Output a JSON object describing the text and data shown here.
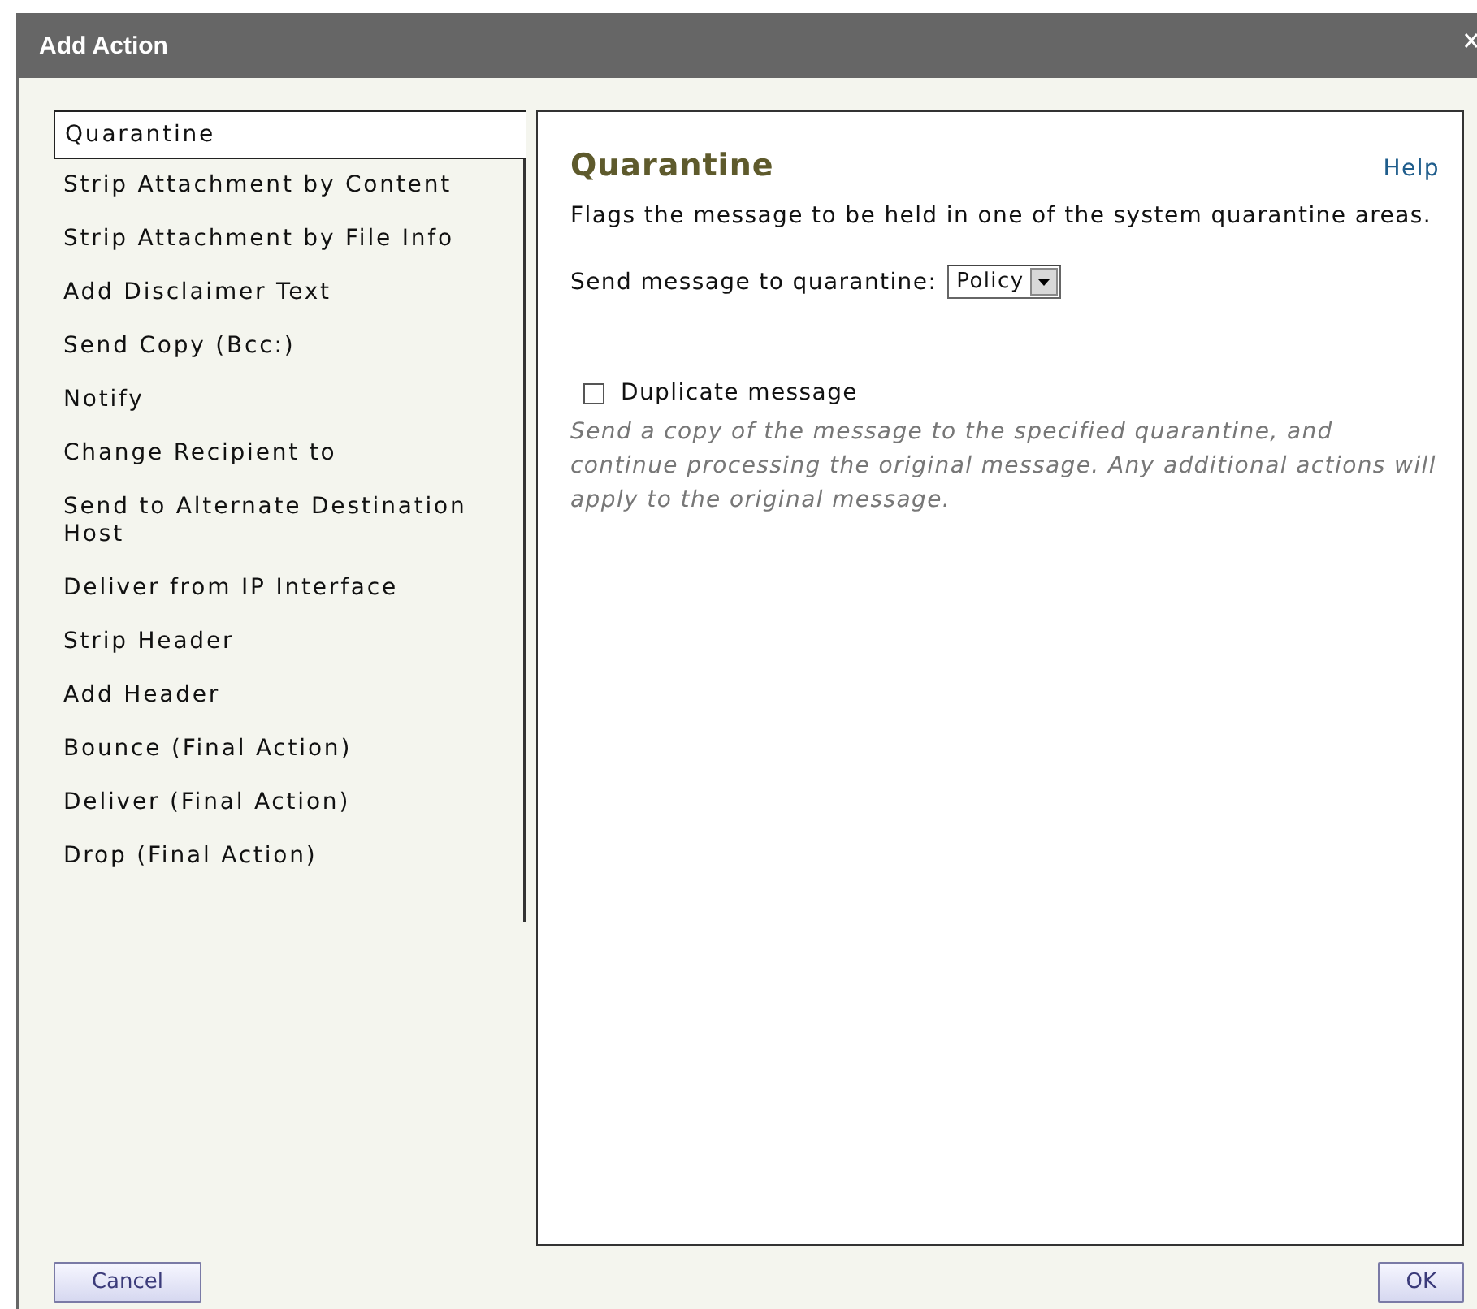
{
  "window": {
    "title": "Add Action"
  },
  "actions": [
    {
      "label": "Quarantine",
      "selected": true
    },
    {
      "label": "Strip Attachment by Content",
      "selected": false
    },
    {
      "label": "Strip Attachment by File Info",
      "selected": false
    },
    {
      "label": "Add Disclaimer Text",
      "selected": false
    },
    {
      "label": "Send Copy (Bcc:)",
      "selected": false
    },
    {
      "label": "Notify",
      "selected": false
    },
    {
      "label": "Change Recipient to",
      "selected": false
    },
    {
      "label": "Send to Alternate Destination Host",
      "selected": false
    },
    {
      "label": "Deliver from IP Interface",
      "selected": false
    },
    {
      "label": "Strip Header",
      "selected": false
    },
    {
      "label": "Add Header",
      "selected": false
    },
    {
      "label": "Bounce (Final Action)",
      "selected": false
    },
    {
      "label": "Deliver (Final Action)",
      "selected": false
    },
    {
      "label": "Drop (Final Action)",
      "selected": false
    }
  ],
  "detail": {
    "title": "Quarantine",
    "help": "Help",
    "description": "Flags the message to be held in one of the system quarantine areas.",
    "quarantine_label": "Send message to quarantine:",
    "quarantine_value": "Policy",
    "duplicate": {
      "label": "Duplicate message",
      "checked": false,
      "hint": "Send a copy of the message to the specified quarantine, and continue processing the original message. Any additional actions will apply to the original message."
    }
  },
  "buttons": {
    "cancel": "Cancel",
    "ok": "OK"
  }
}
